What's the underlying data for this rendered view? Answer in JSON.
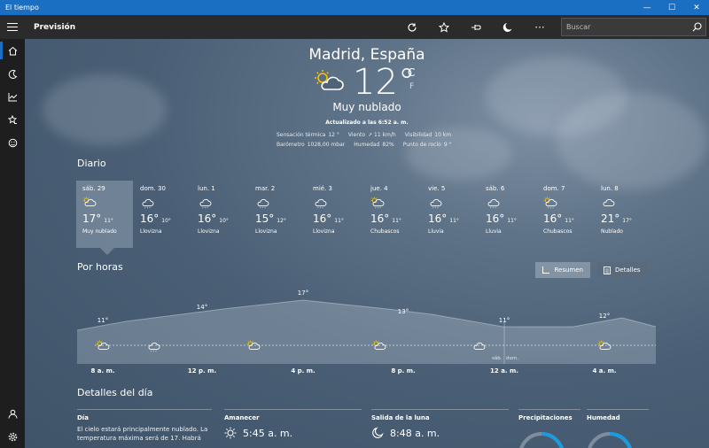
{
  "window": {
    "title": "El tiempo",
    "minimize": "—",
    "maximize": "☐",
    "close": "✕"
  },
  "appbar": {
    "section": "Previsión",
    "tools": [
      "refresh-icon",
      "favorite-icon",
      "pin-icon",
      "moon-icon",
      "more-icon"
    ],
    "more_label": "···",
    "search_placeholder": "Buscar"
  },
  "nav": {
    "items": [
      "home-icon",
      "maps-icon",
      "historical-icon",
      "favorites-icon",
      "life-icon"
    ],
    "bottom": [
      "account-icon",
      "settings-icon"
    ]
  },
  "hero": {
    "location": "Madrid, España",
    "temp": "12°",
    "unit_c": "C",
    "unit_f": "F",
    "condition": "Muy nublado",
    "updated": "Actualizado a las 6:52 a. m.",
    "stats_row1": [
      {
        "label": "Sensación térmica",
        "value": "12 °"
      },
      {
        "label": "Viento",
        "value": "↗ 11 km/h"
      },
      {
        "label": "Visibilidad",
        "value": "10 km"
      }
    ],
    "stats_row2": [
      {
        "label": "Barómetro",
        "value": "1028,00 mbar"
      },
      {
        "label": "Humedad",
        "value": "82%"
      },
      {
        "label": "Punto de rocío",
        "value": "9 °"
      }
    ]
  },
  "daily": {
    "title": "Diario",
    "days": [
      {
        "name": "sáb. 29",
        "hi": "17°",
        "lo": "11°",
        "cond": "Muy nublado",
        "icon": "partly-cloudy-icon"
      },
      {
        "name": "dom. 30",
        "hi": "16°",
        "lo": "10°",
        "cond": "Llovizna",
        "icon": "drizzle-icon"
      },
      {
        "name": "lun. 1",
        "hi": "16°",
        "lo": "10°",
        "cond": "Llovizna",
        "icon": "drizzle-icon"
      },
      {
        "name": "mar. 2",
        "hi": "15°",
        "lo": "12°",
        "cond": "Llovizna",
        "icon": "drizzle-icon"
      },
      {
        "name": "mié. 3",
        "hi": "16°",
        "lo": "11°",
        "cond": "Llovizna",
        "icon": "drizzle-icon"
      },
      {
        "name": "jue. 4",
        "hi": "16°",
        "lo": "11°",
        "cond": "Chubascos",
        "icon": "showers-icon"
      },
      {
        "name": "vie. 5",
        "hi": "16°",
        "lo": "11°",
        "cond": "Lluvia",
        "icon": "rain-icon"
      },
      {
        "name": "sáb. 6",
        "hi": "16°",
        "lo": "11°",
        "cond": "Lluvia",
        "icon": "rain-icon"
      },
      {
        "name": "dom. 7",
        "hi": "16°",
        "lo": "11°",
        "cond": "Chubascos",
        "icon": "showers-icon"
      },
      {
        "name": "lun. 8",
        "hi": "21°",
        "lo": "17°",
        "cond": "Nublado",
        "icon": "cloudy-icon"
      }
    ]
  },
  "hourly": {
    "title": "Por horas",
    "summary_label": "Resumen",
    "details_label": "Detalles",
    "hours": [
      "8 a. m.",
      "12 p. m.",
      "4 p. m.",
      "8 p. m.",
      "12 a. m.",
      "4 a. m."
    ],
    "temps": [
      "11°",
      "14°",
      "17°",
      "13°",
      "11°",
      "12°"
    ],
    "day_sep_left": "sáb.",
    "day_sep_right": "dom."
  },
  "details": {
    "title": "Detalles del día",
    "day_head": "Día",
    "day_text": "El cielo estará principalmente nublado. La temperatura máxima será de 17. Habrá",
    "sunrise_head": "Amanecer",
    "sunrise_value": "5:45 a. m.",
    "moonrise_head": "Salida de la luna",
    "moonrise_value": "8:48 a. m.",
    "precip_head": "Precipitaciones",
    "humidity_head": "Humedad"
  },
  "colors": {
    "titlebar": "#1a6fc2",
    "appbar": "#2b2b2b",
    "nav": "#1e1e1e",
    "accent": "#1a9be0"
  }
}
